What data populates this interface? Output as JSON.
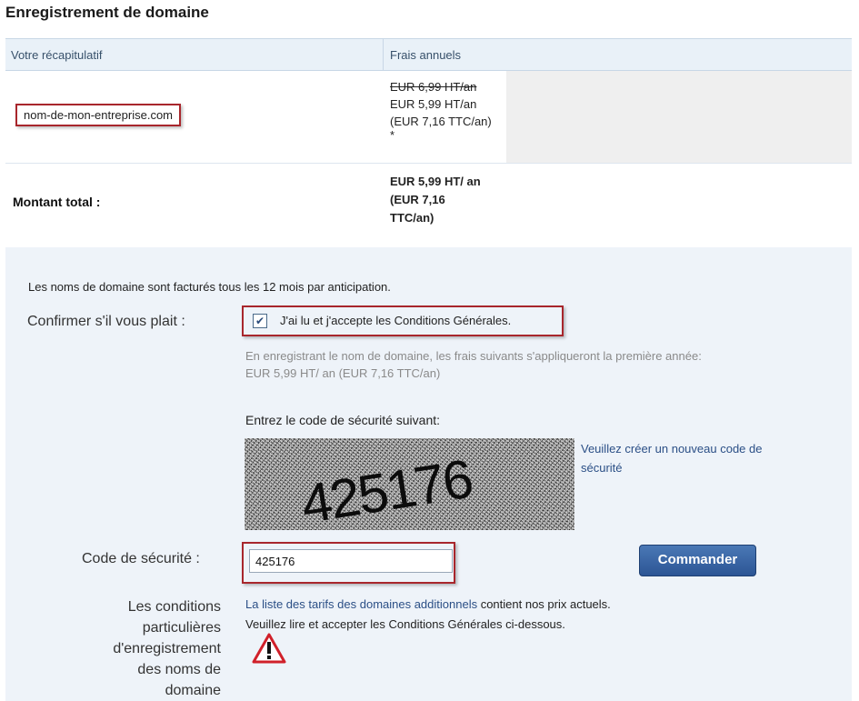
{
  "page": {
    "title": "Enregistrement de domaine"
  },
  "summary": {
    "col_summary": "Votre récapitulatif",
    "col_fees": "Frais annuels",
    "domain": "nom-de-mon-entreprise.com",
    "price_old": "EUR 6,99 HT/an",
    "price_new": "EUR 5,99 HT/an",
    "price_ttc": "(EUR 7,16 TTC/an)",
    "price_asterisk": "*",
    "total_label": "Montant total :",
    "total_line1": "EUR 5,99 HT/ an",
    "total_line2": "(EUR 7,16",
    "total_line3": "TTC/an)"
  },
  "form": {
    "billing_note": "Les noms de domaine sont facturés tous les 12 mois par anticipation.",
    "confirm_label": "Confirmer s'il vous plait :",
    "confirm_checkbox": "J'ai lu et j'accepte les Conditions Générales.",
    "confirm_checked": true,
    "fee_note_line1": "En enregistrant le nom de domaine, les frais suivants s'appliqueront la première année:",
    "fee_note_line2": "EUR 5,99 HT/ an (EUR 7,16 TTC/an)",
    "captcha_title": "Entrez le code de sécurité suivant:",
    "captcha_value": "425176",
    "new_code_link": "Veuillez créer un nouveau code de sécurité",
    "code_label": "Code de sécurité :",
    "code_value": "425176",
    "order_button": "Commander",
    "terms_label": "Les conditions particulières d'enregistrement des noms de domaine",
    "terms_link": "La liste des tarifs des domaines additionnels",
    "terms_text1": " contient nos prix actuels.",
    "terms_text2": "Veuillez lire et accepter les Conditions Générales ci-dessous.",
    "warning_icon": "warning-triangle-icon"
  }
}
